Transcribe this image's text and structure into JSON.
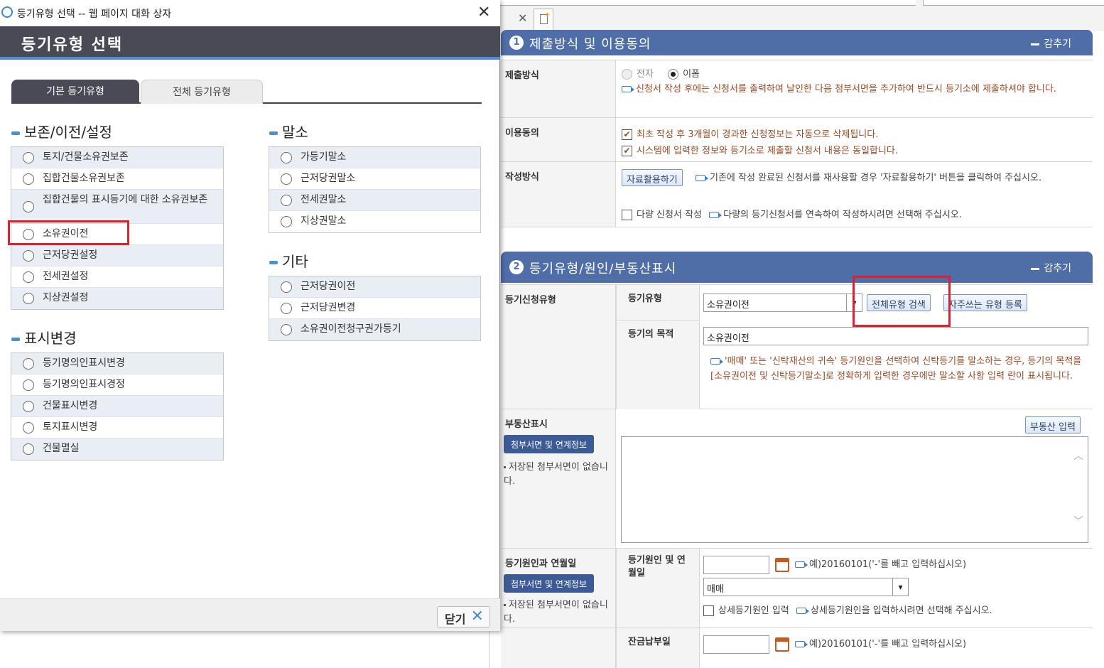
{
  "dialog": {
    "window_title": "등기유형 선택 -- 웹 페이지 대화 상자",
    "header_title": "등기유형 선택",
    "tabs": [
      {
        "label": "기본 등기유형",
        "active": true
      },
      {
        "label": "전체 등기유형",
        "active": false
      }
    ],
    "groups": {
      "preserve": {
        "title": "보존/이전/설정",
        "options": [
          "토지/건물소유권보존",
          "집합건물소유권보존",
          "집합건물의 표시등기에 대한 소유권보존",
          "소유권이전",
          "근저당권설정",
          "전세권설정",
          "지상권설정"
        ]
      },
      "cancel": {
        "title": "말소",
        "options": [
          "가등기말소",
          "근저당권말소",
          "전세권말소",
          "지상권말소"
        ]
      },
      "other": {
        "title": "기타",
        "options": [
          "근저당권이전",
          "근저당권변경",
          "소유권이전청구권가등기"
        ]
      },
      "display_change": {
        "title": "표시변경",
        "options": [
          "등기명의인표시변경",
          "등기명의인표시경정",
          "건물표시변경",
          "토지표시변경",
          "건물멸실"
        ]
      }
    },
    "close_label": "닫기",
    "highlight_color": "#e0202a",
    "accent_color": "#4d8ed0"
  },
  "page": {
    "section1": {
      "number": "1",
      "title": "제출방식 및 이용동의",
      "toggle": "감추기",
      "submit_label": "제출방식",
      "submit_options": [
        "전자",
        "이폼"
      ],
      "submit_selected": "이폼",
      "submit_note": "신청서 작성 후에는 신청서를 출력하여 날인한 다음 첨부서면을 추가하여 반드시 등기소에 제출하셔야 합니다.",
      "consent_label": "이용동의",
      "consent_items": [
        "최초 작성 후 3개월이 경과한 신청정보는 자동으로 삭제됩니다.",
        "시스템에 입력한 정보와 등기소로 제출할 신청서 내용은 동일합니다."
      ],
      "method_label": "작성방식",
      "reuse_button": "자료활용하기",
      "reuse_note": "기존에 작성 완료된 신청서를 재사용할 경우 '자료활용하기' 버튼을 클릭하여 주십시오.",
      "multi_label": "다량 신청서 작성",
      "multi_note": "다량의 등기신청서를 연속하여 작성하시려면 선택해 주십시오."
    },
    "section2": {
      "number": "2",
      "title": "등기유형/원인/부동산표시",
      "toggle": "감추기",
      "apply_type_label": "등기신청유형",
      "type_label": "등기유형",
      "type_value": "소유권이전",
      "search_all_button": "전체유형 검색",
      "favorite_button": "자주쓰는 유형 등록",
      "purpose_label": "등기의 목적",
      "purpose_value": "소유권이전",
      "purpose_note": "'매매' 또는 '신탁재산의 귀속' 등기원인을 선택하여 신탁등기를 말소하는 경우, 등기의 목적을 [소유권이전 및 신탁등기말소]로 정확하게 입력한 경우에만 말소할 사항 입력 란이 표시됩니다.",
      "property_label": "부동산표시",
      "attach_button": "첨부서면 및 연계정보",
      "no_attach_note": "저장된 첨부서면이 없습니다.",
      "property_input_button": "부동산 입력",
      "cause_label": "등기원인과 연월일",
      "cause_date_label": "등기원인 및 연월일",
      "date_hint": "예)20160101('-'를 빼고 입력하십시오)",
      "cause_select": "매매",
      "detail_cause_label": "상세등기원인 입력",
      "detail_cause_note": "상세등기원인을 입력하시려면 선택해 주십시오.",
      "balance_label": "잔금납부일"
    }
  }
}
